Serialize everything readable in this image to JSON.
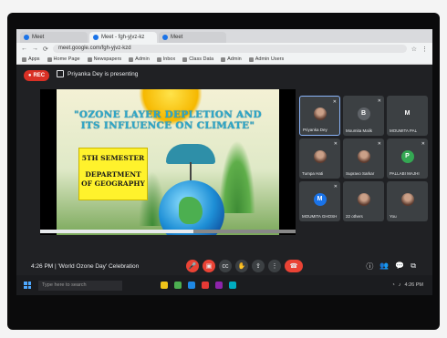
{
  "browser": {
    "tabs": [
      {
        "label": "Meet"
      },
      {
        "label": "Meet - fgh-yjvz-kz"
      },
      {
        "label": "Meet"
      }
    ],
    "address": "meet.google.com/fgh-yjvz-kzd"
  },
  "bookmarks": [
    "Apps",
    "Home Page",
    "Newspapers",
    "Admin",
    "Inbox",
    "Class Data",
    "Admin",
    "Admin Users"
  ],
  "meeting": {
    "rec_label": "REC",
    "presenting_text": "Priyanka Dey is presenting",
    "info": "4:26 PM  |  'World Ozone Day' Celebration"
  },
  "slide": {
    "title_line1": "\"OZONE LAYER DEPLETION AND",
    "title_line2": "ITS INFLUENCE ON CLIMATE\"",
    "semester": "5TH SEMESTER",
    "dept_line1": "DEPARTMENT",
    "dept_line2": "OF GEOGRAPHY"
  },
  "participants": [
    {
      "name": "Priyanka Dey",
      "avatar": "photo",
      "color": "#caa088"
    },
    {
      "name": "Moumita Malik",
      "avatar": "B",
      "color": "#5f6368"
    },
    {
      "name": "MOUMITA PAL",
      "avatar": "M",
      "color": "#3c4043"
    },
    {
      "name": "Tumpa Hati",
      "avatar": "photo",
      "color": "#caa088"
    },
    {
      "name": "Supravo Sarkar",
      "avatar": "photo",
      "color": "#caa088"
    },
    {
      "name": "PALLABI MAJHI",
      "avatar": "P",
      "color": "#34a853"
    },
    {
      "name": "MOUMITA GHOSH",
      "avatar": "M",
      "color": "#1a73e8"
    },
    {
      "name": "22 others",
      "avatar": "photo",
      "color": "#caa088"
    },
    {
      "name": "You",
      "avatar": "photo",
      "color": "#caa088"
    }
  ],
  "taskbar": {
    "search_placeholder": "Type here to search",
    "clock": "4:26 PM"
  }
}
